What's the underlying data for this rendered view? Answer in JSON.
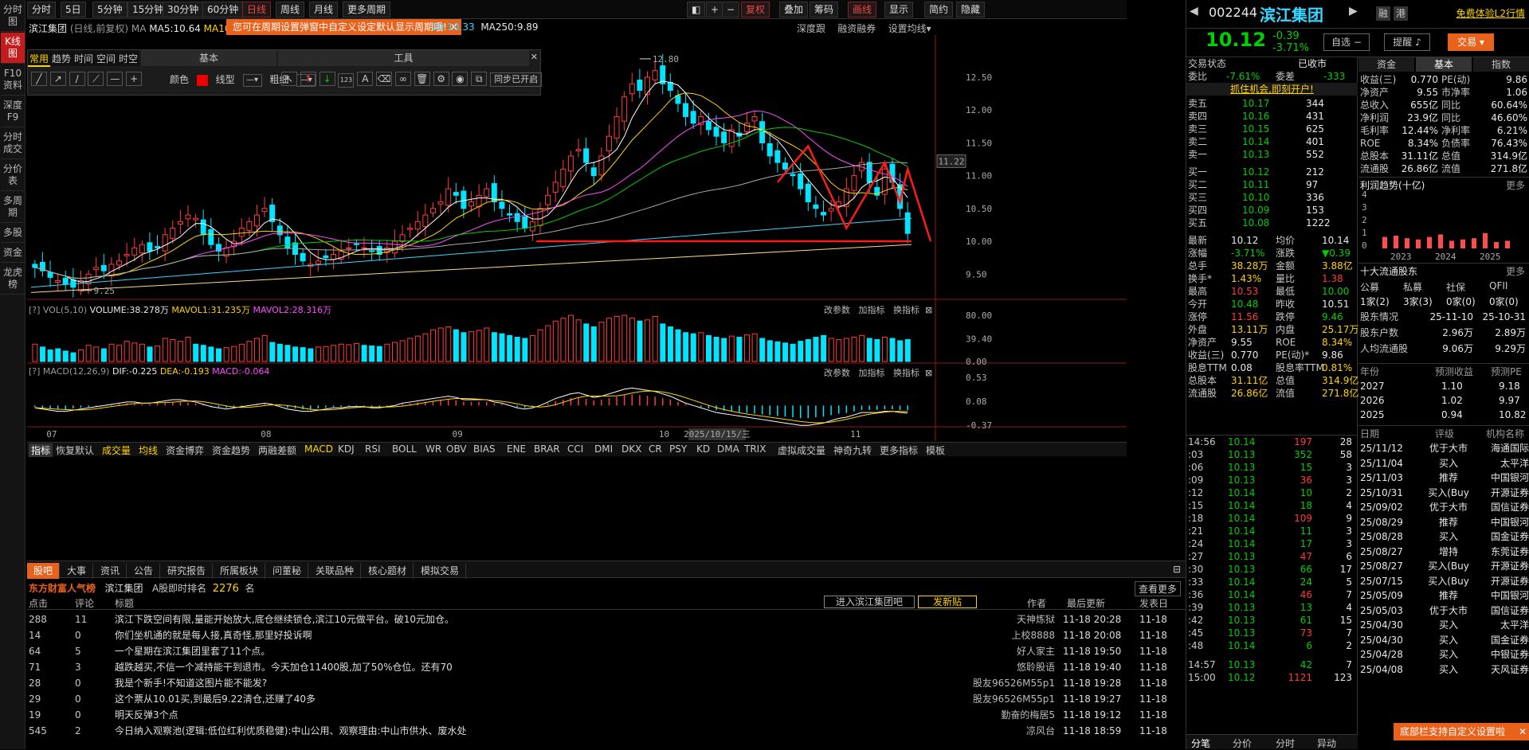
{
  "left_bar": [
    "分时图",
    "K线图",
    "F10资料",
    "深度F9",
    "分时成交",
    "分价表",
    "多周期",
    "多股",
    "资金",
    "龙虎榜"
  ],
  "top_tabs": [
    "分时",
    "5日",
    "5分钟",
    "15分钟",
    "30分钟",
    "60分钟",
    "日线",
    "周线",
    "月线",
    "更多周期"
  ],
  "top_tools": [
    "复权",
    "叠加",
    "筹码",
    "画线",
    "显示",
    "简约",
    "隐藏"
  ],
  "chart_header": {
    "name": "滨江集团",
    "mode": "(日线,前复权)",
    "ma_label": "MA",
    "ma5": "MA5:10.64",
    "ma10": "MA10:",
    "ma20": "20:10.33",
    "ma250": "MA250:9.89",
    "tooltip": "您可在周期设置弹窗中自定义设定默认显示周期哦!",
    "links": [
      "深度跟",
      "融资融券",
      "设置均线"
    ]
  },
  "draw_toolbar": {
    "tabs": [
      "常用",
      "趋势",
      "时间",
      "空间",
      "时空"
    ],
    "basic": "基本",
    "tools": "工具",
    "color": "颜色",
    "line_type": "线型",
    "thickness": "粗细",
    "sync": "同步已开启"
  },
  "price_axis": [
    "12.50",
    "12.00",
    "11.50",
    "11.00",
    "10.50",
    "10.00",
    "9.50"
  ],
  "current_price_label": "11.22",
  "annotations": {
    "high": "12.80",
    "low": "9.25"
  },
  "vol_header": {
    "title": "VOL(5,10)",
    "volume": "VOLUME:38.278万",
    "mavol1": "MAVOL1:31.235万",
    "mavol2": "MAVOL2:28.316万",
    "links": [
      "改参数",
      "加指标",
      "换指标"
    ]
  },
  "vol_axis": [
    "80.00",
    "39.40",
    "0.00"
  ],
  "macd_header": {
    "title": "MACD(12,26,9)",
    "dif": "DIF:-0.225",
    "dea": "DEA:-0.193",
    "macd": "MACD:-0.064",
    "links": [
      "改参数",
      "加指标",
      "换指标"
    ]
  },
  "macd_axis": [
    "0.53",
    "0.08",
    "-0.37"
  ],
  "x_axis": [
    "07",
    "08",
    "09",
    "10",
    "11"
  ],
  "cursor_date": "2025/10/15/三",
  "indicator_tabs": [
    "指标",
    "恢复默认",
    "成交量",
    "均线",
    "资金博弈",
    "资金趋势",
    "两融差额",
    "MACD",
    "KDJ",
    "RSI",
    "BOLL",
    "WR",
    "OBV",
    "BIAS",
    "ENE",
    "BRAR",
    "CCI",
    "DMI",
    "DKX",
    "CR",
    "PSY",
    "KD",
    "DMA",
    "TRIX",
    "虚拟成交量",
    "神奇九转",
    "更多指标",
    "模板"
  ],
  "stock": {
    "code": "002244",
    "name": "滨江集团",
    "price": "10.12",
    "change": "-0.39",
    "pct": "-3.71%",
    "badges": [
      "融",
      "港"
    ],
    "promo": "免费体验L2行情"
  },
  "stock_buttons": [
    "自选",
    "提醒",
    "交易"
  ],
  "quote_tabs": [
    "资金",
    "基本",
    "指数"
  ],
  "order_book": {
    "status_label": "交易状态",
    "status": "已收市",
    "weibi_label": "委比",
    "weibi": "-7.61%",
    "weicha_label": "委差",
    "weicha": "-333",
    "promo": "抓住机会,即刻开户!",
    "asks": [
      [
        "卖五",
        "10.17",
        "344"
      ],
      [
        "卖四",
        "10.16",
        "431"
      ],
      [
        "卖三",
        "10.15",
        "625"
      ],
      [
        "卖二",
        "10.14",
        "401"
      ],
      [
        "卖一",
        "10.13",
        "552"
      ]
    ],
    "bids": [
      [
        "买一",
        "10.12",
        "212"
      ],
      [
        "买二",
        "10.11",
        "97"
      ],
      [
        "买三",
        "10.10",
        "336"
      ],
      [
        "买四",
        "10.09",
        "153"
      ],
      [
        "买五",
        "10.08",
        "1222"
      ]
    ]
  },
  "stats": [
    [
      "最新",
      "10.12",
      "均价",
      "10.14"
    ],
    [
      "涨幅",
      "-3.71%",
      "涨跌",
      "▼0.39"
    ],
    [
      "总手",
      "38.28万",
      "金额",
      "3.88亿"
    ],
    [
      "换手*",
      "1.43%",
      "量比",
      "1.38"
    ],
    [
      "最高",
      "10.53",
      "最低",
      "10.00"
    ],
    [
      "今开",
      "10.48",
      "昨收",
      "10.51"
    ],
    [
      "涨停",
      "11.56",
      "跌停",
      "9.46"
    ],
    [
      "外盘",
      "13.11万",
      "内盘",
      "25.17万"
    ],
    [
      "净资产",
      "9.55",
      "ROE",
      "8.34%"
    ],
    [
      "收益(三)",
      "0.770",
      "PE(动)*",
      "9.86"
    ],
    [
      "股息TTM",
      "0.08",
      "股息率TTM",
      "0.81%"
    ],
    [
      "总股本",
      "31.11亿",
      "总值",
      "314.9亿"
    ],
    [
      "流通股",
      "26.86亿",
      "流值",
      "271.8亿"
    ]
  ],
  "ticks": [
    [
      "14:56",
      "10.14",
      "197",
      "28"
    ],
    [
      ":03",
      "10.13",
      "352",
      "58"
    ],
    [
      ":06",
      "10.13",
      "15",
      "3"
    ],
    [
      ":09",
      "10.13",
      "36",
      "3"
    ],
    [
      ":12",
      "10.14",
      "10",
      "2"
    ],
    [
      ":15",
      "10.14",
      "18",
      "4"
    ],
    [
      ":18",
      "10.14",
      "109",
      "9"
    ],
    [
      ":21",
      "10.14",
      "11",
      "3"
    ],
    [
      ":24",
      "10.14",
      "17",
      "3"
    ],
    [
      ":27",
      "10.13",
      "47",
      "6"
    ],
    [
      ":30",
      "10.13",
      "66",
      "17"
    ],
    [
      ":33",
      "10.14",
      "24",
      "5"
    ],
    [
      ":36",
      "10.14",
      "46",
      "7"
    ],
    [
      ":39",
      "10.13",
      "13",
      "4"
    ],
    [
      ":42",
      "10.13",
      "61",
      "15"
    ],
    [
      ":45",
      "10.13",
      "73",
      "7"
    ],
    [
      ":48",
      "10.14",
      "6",
      "2"
    ],
    [
      "14:57",
      "10.13",
      "42",
      "7"
    ],
    [
      "15:00",
      "10.12",
      "1121",
      "123"
    ]
  ],
  "fundamentals": [
    [
      "收益(三)",
      "0.770",
      "PE(动)",
      "9.86"
    ],
    [
      "净资产",
      "9.55",
      "市净率",
      "1.06"
    ],
    [
      "总收入",
      "655亿",
      "同比",
      "60.64%"
    ],
    [
      "净利润",
      "23.9亿",
      "同比",
      "46.60%"
    ],
    [
      "毛利率",
      "12.44%",
      "净利率",
      "6.21%"
    ],
    [
      "ROE",
      "8.34%",
      "负债率",
      "76.43%"
    ],
    [
      "总股本",
      "31.11亿",
      "总值",
      "314.9亿"
    ],
    [
      "流通股",
      "26.86亿",
      "流值",
      "271.8亿"
    ]
  ],
  "profit_trend": {
    "title": "利润趋势(十亿)",
    "more": "更多",
    "axis": [
      "4",
      "3",
      "2",
      "1",
      "0"
    ],
    "years": [
      "2023",
      "2024",
      "2025"
    ]
  },
  "holders": {
    "title": "十大流通股东",
    "more": "更多",
    "cols": [
      "公募",
      "私募",
      "社保",
      "QFII"
    ],
    "vals": [
      "1家(2)",
      "3家(3)",
      "0家(0)",
      "0家(0)"
    ],
    "rows": [
      [
        "股东情况",
        "25-11-10",
        "25-10-31"
      ],
      [
        "股东户数",
        "2.96万",
        "2.89万"
      ],
      [
        "人均流通股",
        "9.06万",
        "9.29万"
      ]
    ]
  },
  "forecast": {
    "head": [
      "年份",
      "预测收益",
      "预测PE"
    ],
    "rows": [
      [
        "2027",
        "1.10",
        "9.18"
      ],
      [
        "2026",
        "1.02",
        "9.97"
      ],
      [
        "2025",
        "0.94",
        "10.82"
      ]
    ]
  },
  "ratings": {
    "head": [
      "日期",
      "评级",
      "机构名称"
    ],
    "rows": [
      [
        "25/11/12",
        "优于大市",
        "海通国际"
      ],
      [
        "25/11/04",
        "买入",
        "太平洋"
      ],
      [
        "25/11/03",
        "推荐",
        "中国银河"
      ],
      [
        "25/10/31",
        "买入(Buy",
        "开源证券"
      ],
      [
        "25/09/02",
        "优于大市",
        "国信证券"
      ],
      [
        "25/08/29",
        "推荐",
        "中国银河"
      ],
      [
        "25/08/28",
        "买入",
        "国金证券"
      ],
      [
        "25/08/27",
        "增持",
        "东莞证券"
      ],
      [
        "25/08/27",
        "买入(Buy",
        "开源证券"
      ],
      [
        "25/07/15",
        "买入(Buy",
        "开源证券"
      ],
      [
        "25/05/09",
        "推荐",
        "中国银河"
      ],
      [
        "25/05/03",
        "优于大市",
        "国信证券"
      ],
      [
        "25/04/30",
        "买入",
        "太平洋"
      ],
      [
        "25/04/30",
        "买入",
        "国金证券"
      ],
      [
        "25/04/28",
        "买入",
        "中银证券"
      ],
      [
        "25/04/08",
        "买入",
        "天风证券"
      ]
    ]
  },
  "bottom_notice": "底部栏支持自定义设置啦",
  "bottom_tabs_right": [
    "分笔",
    "分价",
    "分时",
    "异动"
  ],
  "bottom": {
    "tabs": [
      "股吧",
      "大事",
      "资讯",
      "公告",
      "研究报告",
      "所属板块",
      "问董秘",
      "关联品种",
      "核心题材",
      "模拟交易"
    ],
    "brand": "东方财富人气榜",
    "stock": "滨江集团",
    "rank_label": "A股即时排名",
    "rank": "2276",
    "rank_unit": "名",
    "more": "查看更多",
    "enter_btn": "进入滨江集团吧",
    "post_btn": "发新贴",
    "cols": [
      "点击",
      "评论",
      "标题",
      "作者",
      "最后更新",
      "发表日"
    ],
    "posts": [
      [
        "288",
        "11",
        "滨江下跌空间有限,量能开始放大,底仓继续锁仓,滨江10元做平台。破10元加仓。",
        "天神炼狱",
        "11-18 20:28",
        "11-18"
      ],
      [
        "14",
        "0",
        "你们坐机通的就是每人接,真奇怪,那里好投诉啊",
        "上校8888",
        "11-18 20:08",
        "11-18"
      ],
      [
        "64",
        "5",
        "一个星期在滨江集团里套了11个点。",
        "好人家主",
        "11-18 19:50",
        "11-18"
      ],
      [
        "71",
        "3",
        "越跌越买,不信一个减持能干到退市。今天加仓11400股,加了50%仓位。还有70",
        "悠聆股语",
        "11-18 19:40",
        "11-18"
      ],
      [
        "28",
        "0",
        "我是个新手!不知道这图片能不能发?",
        "股友96526M55p1",
        "11-18 19:28",
        "11-18"
      ],
      [
        "29",
        "0",
        "这个票从10.01买,到最后9.22清仓,还赚了40多",
        "股友96526M55p1",
        "11-18 19:27",
        "11-18"
      ],
      [
        "19",
        "0",
        "明天反弹3个点",
        "勤奋的梅居5",
        "11-18 19:12",
        "11-18"
      ],
      [
        "545",
        "2",
        "今日纳入观察池(逻辑:低位红利优质稳健):中山公用、观察理由:中山市供水、废水处",
        "凉风台",
        "11-18 18:59",
        "11-18"
      ]
    ]
  },
  "chart_data": [
    {
      "type": "candlestick",
      "title": "滨江集团 (日线,前复权)",
      "x_ticks": [
        "07",
        "08",
        "09",
        "10",
        "11"
      ],
      "ylim": [
        9.2,
        12.9
      ],
      "y_ticks": [
        9.5,
        10.0,
        10.5,
        11.0,
        11.5,
        12.0,
        12.5
      ],
      "series": [
        {
          "name": "MA5",
          "value": 10.64
        },
        {
          "name": "MA20",
          "value": 10.33
        },
        {
          "name": "MA250",
          "value": 9.89
        }
      ],
      "close": [
        9.6,
        9.55,
        9.45,
        9.4,
        9.35,
        9.3,
        9.4,
        9.5,
        9.6,
        9.55,
        9.65,
        9.7,
        9.8,
        9.9,
        9.95,
        9.85,
        9.9,
        10.1,
        10.2,
        10.3,
        10.4,
        10.35,
        10.1,
        9.95,
        9.85,
        9.9,
        10.0,
        10.2,
        10.3,
        10.4,
        10.5,
        10.3,
        10.1,
        9.9,
        9.8,
        9.7,
        9.65,
        9.7,
        9.75,
        9.8,
        9.85,
        9.9,
        9.95,
        9.9,
        9.85,
        9.8,
        9.9,
        10.0,
        10.1,
        10.2,
        10.3,
        10.4,
        10.5,
        10.6,
        10.8,
        10.7,
        10.5,
        10.6,
        10.7,
        10.8,
        10.6,
        10.5,
        10.4,
        10.3,
        10.2,
        10.3,
        10.5,
        10.7,
        10.9,
        11.1,
        11.3,
        11.4,
        11.2,
        11.0,
        11.3,
        11.6,
        11.9,
        12.2,
        12.4,
        12.3,
        12.5,
        12.6,
        12.4,
        12.3,
        12.1,
        11.9,
        11.8,
        11.9,
        11.7,
        11.6,
        11.5,
        11.7,
        11.6,
        11.8,
        11.9,
        11.5,
        11.3,
        11.2,
        11.1,
        11.0,
        10.8,
        10.6,
        10.5,
        10.4,
        10.5,
        10.6,
        10.8,
        11.0,
        11.2,
        10.9,
        10.7,
        11.1,
        10.9,
        10.5,
        10.12
      ]
    },
    {
      "type": "bar",
      "title": "VOL(5,10)",
      "ylim": [
        0,
        80
      ],
      "y_ticks": [
        0,
        39.4,
        80
      ],
      "values": [
        30,
        25,
        20,
        22,
        18,
        15,
        20,
        28,
        25,
        22,
        30,
        28,
        35,
        32,
        30,
        25,
        27,
        40,
        38,
        35,
        42,
        30,
        28,
        25,
        22,
        24,
        26,
        30,
        35,
        40,
        45,
        33,
        30,
        28,
        25,
        24,
        22,
        25,
        26,
        28,
        30,
        29,
        31,
        28,
        27,
        26,
        30,
        33,
        36,
        40,
        44,
        48,
        55,
        58,
        60,
        55,
        50,
        52,
        54,
        58,
        50,
        48,
        45,
        42,
        40,
        45,
        55,
        62,
        70,
        75,
        80,
        72,
        65,
        60,
        68,
        75,
        78,
        80,
        75,
        70,
        72,
        78,
        65,
        60,
        55,
        50,
        48,
        50,
        45,
        42,
        40,
        44,
        42,
        46,
        48,
        40,
        36,
        34,
        32,
        30,
        35,
        38,
        42,
        45,
        40,
        38,
        40,
        42,
        45,
        40,
        38,
        42,
        40,
        36,
        38
      ],
      "series": [
        {
          "name": "VOLUME",
          "value": "38.278万"
        },
        {
          "name": "MAVOL1",
          "value": "31.235万"
        },
        {
          "name": "MAVOL2",
          "value": "28.316万"
        }
      ]
    },
    {
      "type": "bar",
      "title": "MACD(12,26,9)",
      "ylim": [
        -0.37,
        0.53
      ],
      "y_ticks": [
        -0.37,
        0.08,
        0.53
      ],
      "values": [
        -0.02,
        -0.03,
        -0.04,
        -0.05,
        -0.05,
        -0.04,
        -0.03,
        -0.02,
        -0.01,
        0.0,
        0.01,
        0.02,
        0.03,
        0.03,
        0.02,
        0.02,
        0.03,
        0.04,
        0.05,
        0.05,
        0.04,
        0.03,
        0.01,
        -0.01,
        -0.02,
        -0.03,
        -0.02,
        -0.01,
        0.0,
        0.01,
        0.02,
        0.01,
        -0.01,
        -0.03,
        -0.04,
        -0.05,
        -0.05,
        -0.04,
        -0.03,
        -0.02,
        -0.02,
        -0.01,
        -0.01,
        -0.01,
        -0.02,
        -0.02,
        -0.01,
        0.0,
        0.02,
        0.03,
        0.04,
        0.05,
        0.06,
        0.07,
        0.08,
        0.07,
        0.05,
        0.05,
        0.05,
        0.05,
        0.03,
        0.02,
        0.0,
        -0.02,
        -0.03,
        -0.02,
        0.0,
        0.03,
        0.06,
        0.08,
        0.1,
        0.11,
        0.09,
        0.07,
        0.08,
        0.1,
        0.12,
        0.14,
        0.15,
        0.14,
        0.13,
        0.12,
        0.1,
        0.08,
        0.05,
        0.02,
        0.0,
        -0.02,
        -0.04,
        -0.06,
        -0.07,
        -0.08,
        -0.09,
        -0.1,
        -0.11,
        -0.12,
        -0.13,
        -0.14,
        -0.15,
        -0.16,
        -0.17,
        -0.17,
        -0.16,
        -0.15,
        -0.13,
        -0.11,
        -0.1,
        -0.08,
        -0.06,
        -0.06,
        -0.06,
        -0.05,
        -0.05,
        -0.06,
        -0.064
      ],
      "series": [
        {
          "name": "DIF",
          "value": -0.225
        },
        {
          "name": "DEA",
          "value": -0.193
        },
        {
          "name": "MACD",
          "value": -0.064
        }
      ]
    },
    {
      "type": "bar",
      "title": "利润趋势(十亿)",
      "ylim": [
        0,
        4
      ],
      "categories": [
        "2023",
        "2024",
        "2025"
      ],
      "values": [
        0.9,
        1.0,
        0.8,
        0.7,
        0.9,
        1.1,
        0.6,
        0.7,
        0.8,
        1.2,
        0.5,
        0.6
      ]
    }
  ]
}
